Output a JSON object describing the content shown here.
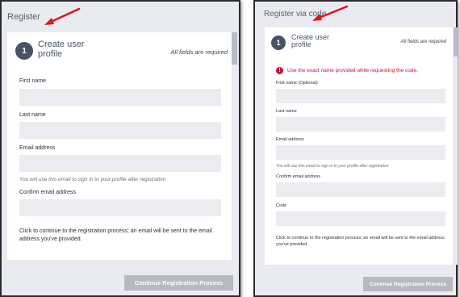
{
  "left": {
    "title": "Register",
    "step_number": "1",
    "step_title": "Create user profile",
    "required_note": "All fields are required",
    "fields": [
      {
        "label": "First name",
        "value": ""
      },
      {
        "label": "Last name",
        "value": ""
      },
      {
        "label": "Email address",
        "value": ""
      },
      {
        "label": "Confirm email address",
        "value": ""
      }
    ],
    "email_hint": "You will use this email to sign in to your profile after registration",
    "footer_text": "Click to continue to the registration process; an email will be sent to the email address you've provided.",
    "continue_button": "Continue Registration Process"
  },
  "right": {
    "title": "Register via code",
    "step_number": "1",
    "step_title": "Create user profile",
    "required_note": "All fields are required",
    "error_message": "Use the exact name provided while requesting the code.",
    "fields": [
      {
        "label": "First name (Optional)",
        "value": ""
      },
      {
        "label": "Last name",
        "value": ""
      },
      {
        "label": "Email address",
        "value": ""
      },
      {
        "label": "Confirm email address",
        "value": ""
      },
      {
        "label": "Code",
        "value": ""
      }
    ],
    "email_hint": "You will use this email to sign in to your profile after registration",
    "footer_text": "Click to continue to the registration process; an email will be sent to the email address you've provided.",
    "continue_button": "Continue Registration Process"
  },
  "colors": {
    "accent_badge": "#4a5366",
    "error": "#c8102e",
    "annotation_arrow": "#e0141e",
    "button_disabled": "#b7bac2"
  },
  "icons": [
    "error-icon",
    "annotation-arrow"
  ]
}
